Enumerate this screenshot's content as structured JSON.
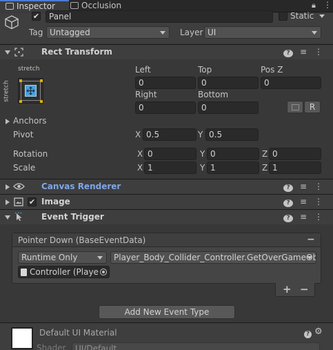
{
  "tabs": {
    "inspector": "Inspector",
    "occlusion": "Occlusion"
  },
  "gameobject": {
    "active": true,
    "name": "Panel",
    "static_label": "Static",
    "tag_label": "Tag",
    "tag_value": "Untagged",
    "layer_label": "Layer",
    "layer_value": "UI"
  },
  "rect_transform": {
    "title": "Rect Transform",
    "anchor_preset_top": "stretch",
    "anchor_preset_side": "stretch",
    "left_label": "Left",
    "left_value": "0",
    "top_label": "Top",
    "top_value": "0",
    "posz_label": "Pos Z",
    "posz_value": "0",
    "right_label": "Right",
    "right_value": "0",
    "bottom_label": "Bottom",
    "bottom_value": "0",
    "raw_button": "R",
    "anchors_label": "Anchors",
    "pivot_label": "Pivot",
    "pivot_x": "0.5",
    "pivot_y": "0.5",
    "rotation_label": "Rotation",
    "rot_x": "0",
    "rot_y": "0",
    "rot_z": "0",
    "scale_label": "Scale",
    "scale_x": "1",
    "scale_y": "1",
    "scale_z": "1",
    "axis_x": "X",
    "axis_y": "Y",
    "axis_z": "Z"
  },
  "canvas_renderer": {
    "title": "Canvas Renderer"
  },
  "image": {
    "title": "Image",
    "enabled": true
  },
  "event_trigger": {
    "title": "Event Trigger",
    "entry_title": "Pointer Down (BaseEventData)",
    "runtime": "Runtime Only",
    "function": "Player_Body_Collider_Controller.GetOverGameObj",
    "target": "Controller (Playe",
    "add": "+",
    "remove": "−",
    "minus": "−",
    "add_event_type": "Add New Event Type"
  },
  "material": {
    "name": "Default UI Material",
    "shader_label": "Shader",
    "shader_value": "UI/Default"
  },
  "header_icons": {
    "help": "?",
    "preset": "≡",
    "menu": "⋮"
  },
  "colors": {
    "accent": "#4c7bd4",
    "anchor_yellow": "#e0b000",
    "link_blue": "#7ea7e8"
  }
}
